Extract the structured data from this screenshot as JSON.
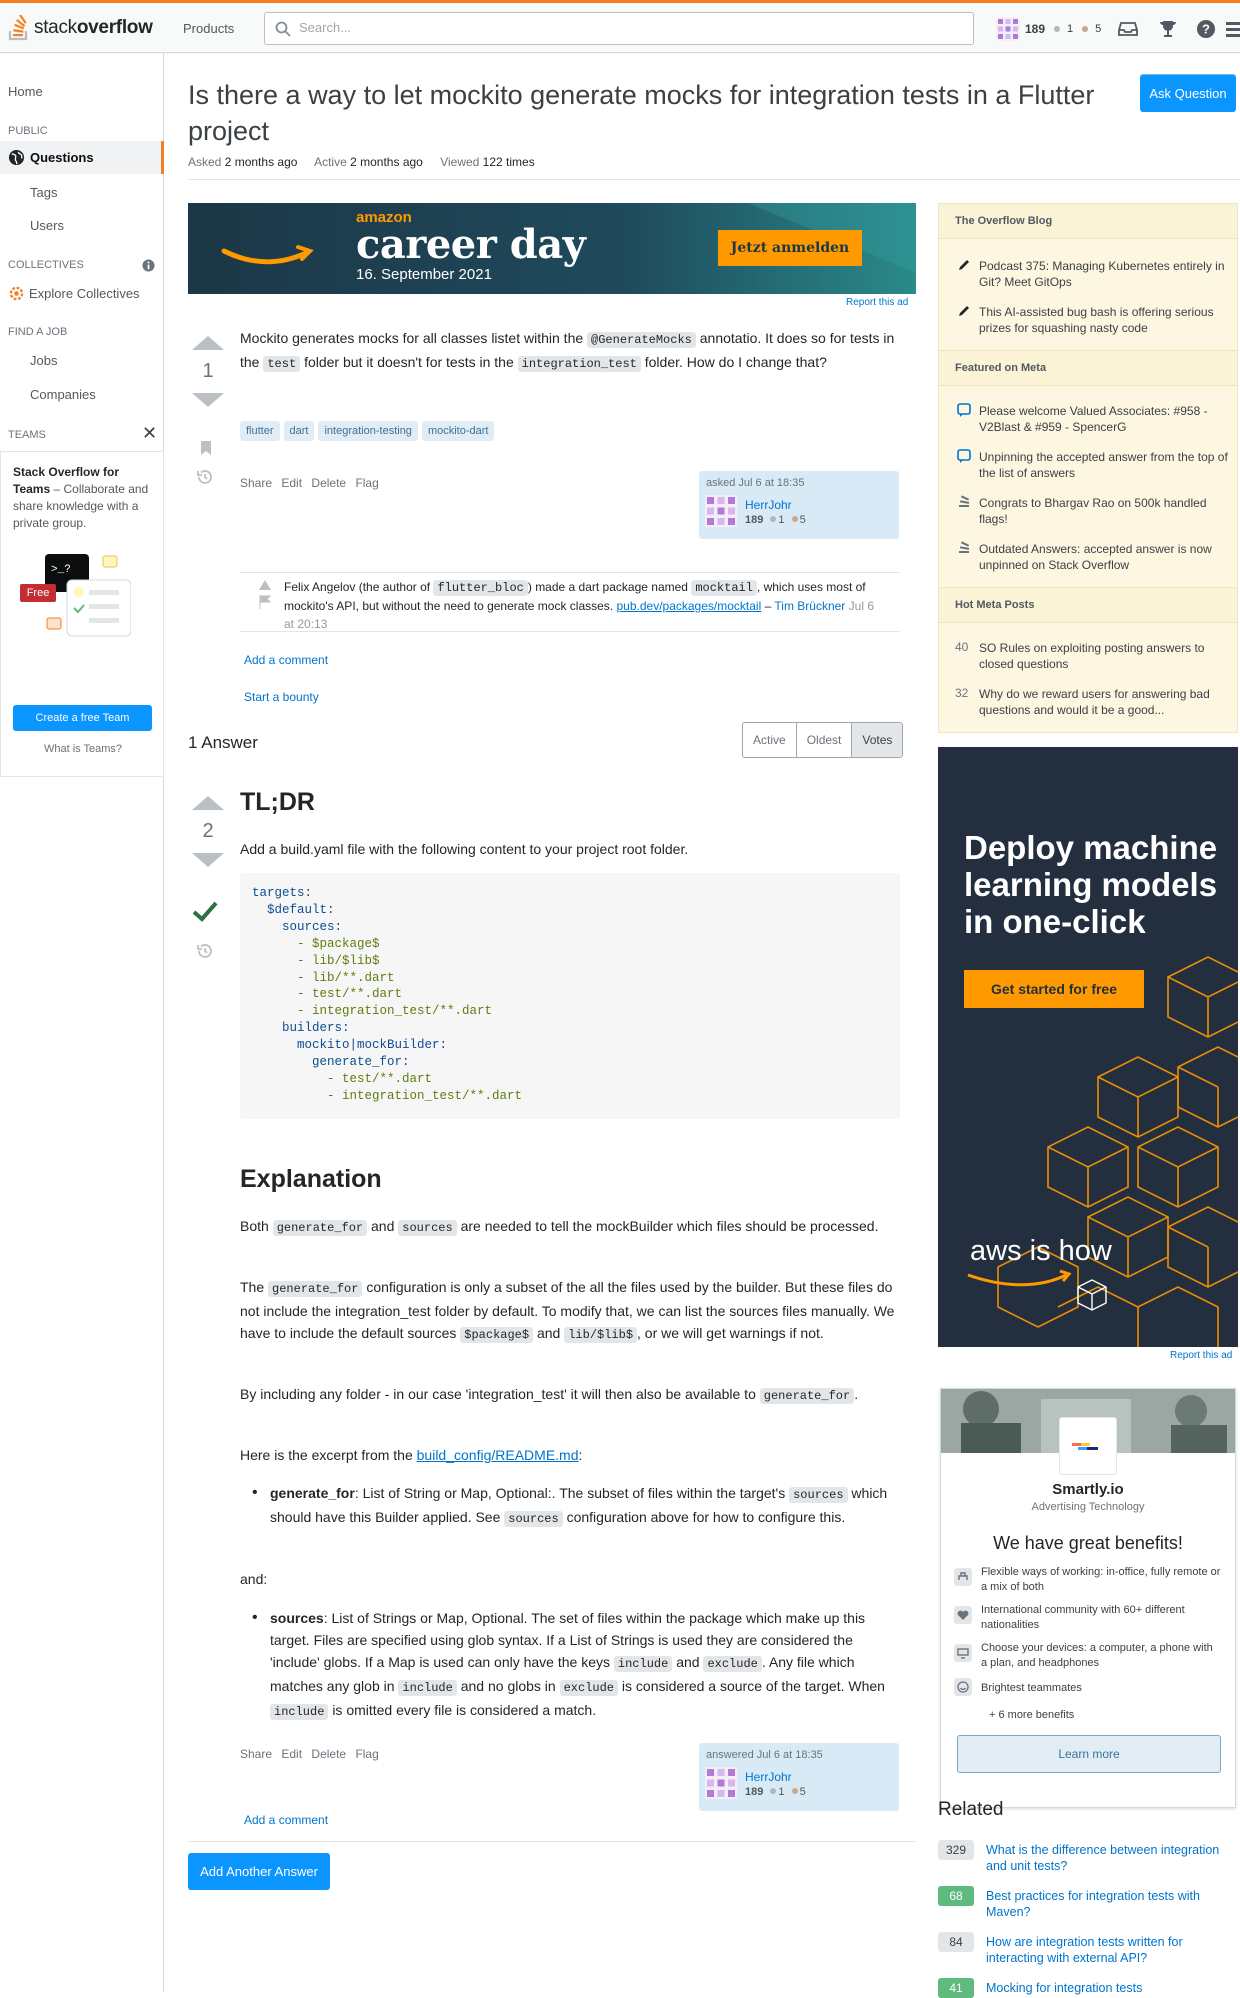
{
  "topbar": {
    "logo_plain": "stack",
    "logo_bold": "overflow",
    "products": "Products",
    "search_placeholder": "Search...",
    "reputation": "189",
    "silver": "1",
    "bronze": "5"
  },
  "leftnav": {
    "home": "Home",
    "public": "PUBLIC",
    "questions": "Questions",
    "tags": "Tags",
    "users": "Users",
    "collectives_head": "COLLECTIVES",
    "explore_collectives": "Explore Collectives",
    "find_job": "FIND A JOB",
    "jobs": "Jobs",
    "companies": "Companies",
    "teams_head": "TEAMS",
    "teams_title": "Stack Overflow for Teams",
    "teams_desc": "– Collaborate and share knowledge with a private group.",
    "free": "Free",
    "create_team": "Create a free Team",
    "what_is_teams": "What is Teams?"
  },
  "question": {
    "title": "Is there a way to let mockito generate mocks for integration tests in a Flutter project",
    "ask_button": "Ask Question",
    "asked_label": "Asked",
    "asked": "2 months ago",
    "active_label": "Active",
    "active": "2 months ago",
    "viewed_label": "Viewed",
    "viewed": "122 times",
    "votes": "1",
    "body": {
      "p1": "Mockito generates mocks for all classes listet within the",
      "c1": "@GenerateMocks",
      "p2": "annotatio. It does so for tests in the",
      "c2": "test",
      "p3": "folder but it doesn't for tests in the",
      "c3": "integration_test",
      "p4": "folder. How do I change that?"
    },
    "tags": [
      "flutter",
      "dart",
      "integration-testing",
      "mockito-dart"
    ],
    "menu": [
      "Share",
      "Edit",
      "Delete",
      "Flag"
    ],
    "owner": {
      "action": "asked Jul 6 at 18:35",
      "name": "HerrJohr",
      "rep": "189",
      "silver": "1",
      "bronze": "5"
    },
    "comment": {
      "t1": "Felix Angelov (the author of",
      "c1": "flutter_bloc",
      "t2": ") made a dart package named",
      "c2": "mocktail",
      "t3": ", which uses most of mockito's API, but without the need to generate mock classes.",
      "link": "pub.dev/packages/mocktail",
      "dash": "–",
      "author": "Tim Brückner",
      "date": "Jul 6 at 20:13"
    },
    "add_comment": "Add a comment",
    "start_bounty": "Start a bounty"
  },
  "ad_banner": {
    "brand": "amazon",
    "headline": "career day",
    "date": "16. September 2021",
    "cta": "Jetzt anmelden",
    "report": "Report this ad"
  },
  "answers": {
    "count": "1 Answer",
    "sort": [
      "Active",
      "Oldest",
      "Votes"
    ]
  },
  "answer": {
    "votes": "2",
    "h_tldr": "TL;DR",
    "p_tldr": "Add a build.yaml file with the following content to your project root folder.",
    "code": [
      {
        "k": "targets:",
        "s": ""
      },
      {
        "k": "  $default:",
        "s": ""
      },
      {
        "k": "    sources:",
        "s": ""
      },
      {
        "k": "",
        "s": "      - $package$"
      },
      {
        "k": "",
        "s": "      - lib/$lib$"
      },
      {
        "k": "",
        "s": "      - lib/**.dart"
      },
      {
        "k": "",
        "s": "      - test/**.dart"
      },
      {
        "k": "",
        "s": "      - integration_test/**.dart"
      },
      {
        "k": "    builders:",
        "s": ""
      },
      {
        "k": "      mockito|mockBuilder:",
        "s": ""
      },
      {
        "k": "        generate_for:",
        "s": ""
      },
      {
        "k": "",
        "s": "          - test/**.dart"
      },
      {
        "k": "",
        "s": "          - integration_test/**.dart"
      }
    ],
    "h_expl": "Explanation",
    "e1": {
      "t1": "Both",
      "c1": "generate_for",
      "t2": "and",
      "c2": "sources",
      "t3": "are needed to tell the mockBuilder which files should be processed."
    },
    "e2": {
      "t1": "The",
      "c1": "generate_for",
      "t2": "configuration is only a subset of the all the files used by the builder. But these files do not include the integration_test folder by default. To modify that, we can list the sources files manually. We have to include the default sources",
      "c2": "$package$",
      "t3": "and",
      "c3": "lib/$lib$",
      "t4": ", or we will get warnings if not."
    },
    "e3": {
      "t1": "By including any folder - in our case 'integration_test' it will then also be available to",
      "c1": "generate_for",
      "t2": "."
    },
    "e4": {
      "t1": "Here is the excerpt from the",
      "link": "build_config/README.md",
      "t2": ":"
    },
    "b1": {
      "strong": "generate_for",
      "t1": ": List of String or Map, Optional:. The subset of files within the target's",
      "c1": "sources",
      "t2": "which should have this Builder applied. See",
      "c2": "sources",
      "t3": "configuration above for how to configure this."
    },
    "and": "and:",
    "b2": {
      "strong": "sources",
      "t1": ": List of Strings or Map, Optional. The set of files within the package which make up this target. Files are specified using glob syntax. If a List of Strings is used they are considered the 'include' globs. If a Map is used can only have the keys",
      "c1": "include",
      "t2": "and",
      "c2": "exclude",
      "t3": ". Any file which matches any glob in",
      "c3": "include",
      "t4": "and no globs in",
      "c4": "exclude",
      "t5": "is considered a source of the target. When",
      "c5": "include",
      "t6": "is omitted every file is considered a match."
    },
    "menu": [
      "Share",
      "Edit",
      "Delete",
      "Flag"
    ],
    "owner": {
      "action": "answered Jul 6 at 18:35",
      "name": "HerrJohr",
      "rep": "189",
      "silver": "1",
      "bronze": "5"
    },
    "add_comment": "Add a comment",
    "add_answer": "Add Another Answer"
  },
  "sidebar": {
    "blog_head": "The Overflow Blog",
    "blog": [
      "Podcast 375: Managing Kubernetes entirely in Git? Meet GitOps",
      "This AI-assisted bug bash is offering serious prizes for squashing nasty code"
    ],
    "meta_head": "Featured on Meta",
    "meta": [
      "Please welcome Valued Associates: #958 - V2Blast & #959 - SpencerG",
      "Unpinning the accepted answer from the top of the list of answers",
      "Congrats to Bhargav Rao on 500k handled flags!",
      "Outdated Answers: accepted answer is now unpinned on Stack Overflow"
    ],
    "hot_head": "Hot Meta Posts",
    "hot": [
      {
        "n": "40",
        "t": "SO Rules on exploiting posting answers to closed questions"
      },
      {
        "n": "32",
        "t": "Why do we reward users for answering bad questions and would it be a good..."
      }
    ]
  },
  "aws_ad": {
    "headline": "Deploy machine learning models in one-click",
    "cta": "Get started for free",
    "tagline": "aws is how",
    "report": "Report this ad"
  },
  "smartly": {
    "name": "Smartly.io",
    "category": "Advertising Technology",
    "benefits_title": "We have great benefits!",
    "benefits": [
      "Flexible ways of working: in-office, fully remote or a mix of both",
      "International community with 60+ different nationalities",
      "Choose your devices: a computer, a phone with a plan, and headphones",
      "Brightest teammates"
    ],
    "more": "+ 6 more benefits",
    "learn_more": "Learn more"
  },
  "related": {
    "title": "Related",
    "items": [
      {
        "n": "329",
        "acc": false,
        "t": "What is the difference between integration and unit tests?"
      },
      {
        "n": "68",
        "acc": true,
        "t": "Best practices for integration tests with Maven?"
      },
      {
        "n": "84",
        "acc": false,
        "t": "How are integration tests written for interacting with external API?"
      },
      {
        "n": "41",
        "acc": true,
        "t": "Mocking for integration tests"
      }
    ]
  },
  "colors": {
    "accent": "#f48024",
    "link": "#0074cc",
    "primary_button": "#0a95ff",
    "accepted": "#5eba7d"
  }
}
